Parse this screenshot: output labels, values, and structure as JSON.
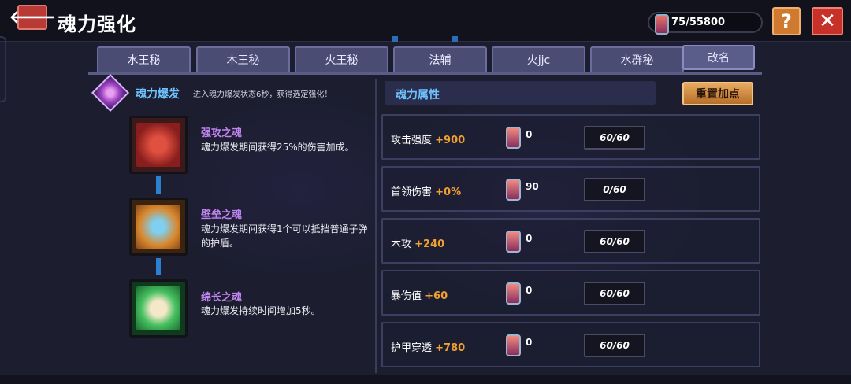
{
  "header": {
    "title": "魂力强化",
    "currency": "75/55800"
  },
  "tabs": [
    "水王秘",
    "木王秘",
    "火王秘",
    "法辅",
    "火jjc",
    "水群秘",
    "改名"
  ],
  "burst": {
    "title": "魂力爆发",
    "desc": "进入魂力爆发状态6秒，获得选定强化！"
  },
  "skills": [
    {
      "name": "强攻之魂",
      "desc": "魂力爆发期间获得25%的伤害加成。",
      "icon": "sword-soul-icon",
      "color": "#b8302a"
    },
    {
      "name": "壁垒之魂",
      "desc": "魂力爆发期间获得1个可以抵挡普通子弹的护盾。",
      "icon": "shield-soul-icon",
      "color": "#d07a28"
    },
    {
      "name": "绵长之魂",
      "desc": "魂力爆发持续时间增加5秒。",
      "icon": "clock-soul-icon",
      "color": "#2fa050"
    }
  ],
  "attributes": {
    "header": "魂力属性",
    "reset_label": "重置加点",
    "rows": [
      {
        "name": "攻击强度",
        "bonus": "+900",
        "cost": "0",
        "level": "60/60"
      },
      {
        "name": "首领伤害",
        "bonus": "+0%",
        "cost": "90",
        "level": "0/60"
      },
      {
        "name": "木攻",
        "bonus": "+240",
        "cost": "0",
        "level": "60/60"
      },
      {
        "name": "暴伤值",
        "bonus": "+60",
        "cost": "0",
        "level": "60/60"
      },
      {
        "name": "护甲穿透",
        "bonus": "+780",
        "cost": "0",
        "level": "60/60"
      }
    ]
  },
  "colors": {
    "accent_blue": "#6ec3ff",
    "bonus_orange": "#f0a030",
    "skill_name_purple": "#c084f0",
    "close_red": "#c8302a",
    "help_orange": "#d07a30"
  }
}
